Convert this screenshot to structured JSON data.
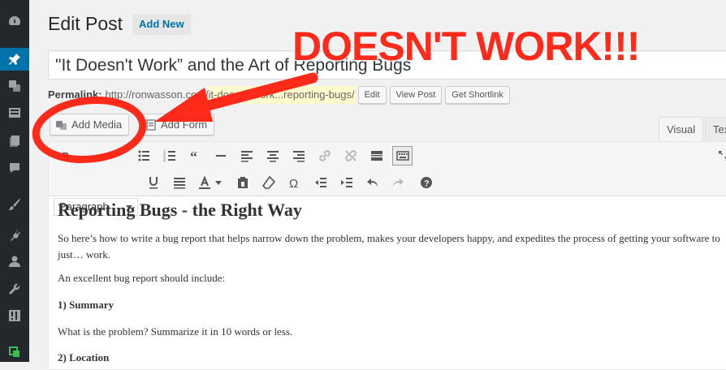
{
  "page": {
    "title": "Edit Post",
    "add_new": "Add New"
  },
  "post": {
    "title": "\"It Doesn't Work” and the Art of Reporting Bugs",
    "permalink_label": "Permalink:",
    "permalink_base": "http://ronwasson.com/",
    "permalink_slug": "it-doesnt-work...reporting-bugs/",
    "buttons": [
      "Edit",
      "View Post",
      "Get Shortlink"
    ]
  },
  "media": {
    "add_media": "Add Media",
    "add_form": "Add Form"
  },
  "tabs": {
    "visual": "Visual",
    "text": "Text"
  },
  "toolbar": {
    "format_select": "Paragraph"
  },
  "content": {
    "heading": "Reporting Bugs - the Right Way",
    "p1": "So here’s how to write a bug report that helps narrow down the problem, makes your developers happy, and expedites the process of getting your software to just… work.",
    "p2": "An excellent bug report should include:",
    "h_summary": "1) Summary",
    "p3": "What is the problem? Summarize it in 10 words or less.",
    "h_location": "2) Location"
  },
  "annotation": {
    "text": "DOESN'T WORK!!!",
    "color": "#ff2a1a"
  },
  "colors": {
    "sidebar_bg": "#23282d",
    "accent": "#0073aa"
  }
}
